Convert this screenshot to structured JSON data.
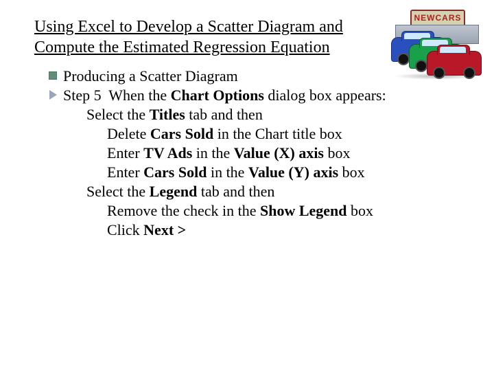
{
  "title_line1": "Using Excel to Develop a Scatter Diagram and",
  "title_line2": "Compute the Estimated Regression Equation",
  "illus_sign": "NEWCARS",
  "producing": "Producing a Scatter Diagram",
  "step5": {
    "prefix": "Step 5  When the ",
    "bold1": "Chart Options",
    "suffix": " dialog box appears:"
  },
  "titles_line": {
    "pre": "Select the ",
    "b": "Titles",
    "post": " tab and then"
  },
  "delete_line": {
    "pre": "Delete ",
    "b": "Cars Sold",
    "post": " in the Chart title box"
  },
  "xaxis_line": {
    "pre": "Enter ",
    "b1": "TV Ads",
    "mid": " in the ",
    "b2": "Value (X) axis",
    "post": " box"
  },
  "yaxis_line": {
    "pre": "Enter ",
    "b1": "Cars Sold",
    "mid": " in the ",
    "b2": "Value (Y) axis",
    "post": " box"
  },
  "legend_line": {
    "pre": "Select the ",
    "b": "Legend",
    "post": " tab and then"
  },
  "remove_line": {
    "pre": "Remove the check in the ",
    "b": "Show Legend",
    "post": " box"
  },
  "click_line": {
    "pre": "Click ",
    "b": "Next >"
  }
}
